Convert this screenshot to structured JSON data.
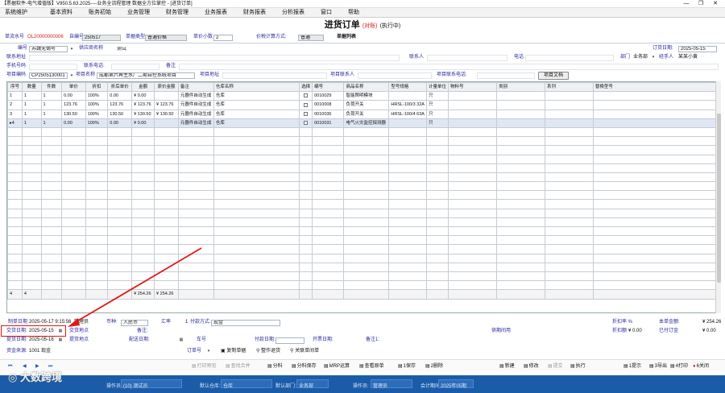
{
  "window": {
    "title": "【票据软件-电气增值版】V950.5.63.2025----业务全流程管理 数据全方位掌控 - [进货订单]",
    "min": "—",
    "max": "❐",
    "close": "✕"
  },
  "menu": [
    "系统维护",
    "基本资料",
    "账务初始",
    "业务管理",
    "财务管理",
    "业务报表",
    "财务报表",
    "分析报表",
    "窗口",
    "帮助"
  ],
  "doc": {
    "title": "进货订单",
    "review": "(对账)",
    "status": "(执行中)"
  },
  "header": {
    "serial_label": "单流水号",
    "serial_value": "OL20000000006",
    "self_no_label": "自编号",
    "self_no_value": "250517",
    "doc_type_label": "单据类型",
    "doc_type_value": "普通价格",
    "unit_dec_label": "单价小数",
    "unit_dec_value": "2",
    "calc_label": "价税计算方式:",
    "calc_value": "普通",
    "list_label": "单据列表",
    "code_label": "编号",
    "code_value": "苏魏无锡号",
    "supplier_label": "供应商名称",
    "supplier_value": "测试",
    "order_date_label": "订货日期:",
    "order_date_value": "2025-05-15",
    "contact_addr_label": "联系地址",
    "contact_label": "联系人",
    "phone_label": "电话",
    "dept_label": "部门",
    "dept_value": "业务部",
    "handler_label": "经手人",
    "handler_value": "某某小黄",
    "mobile_label": "手机号码",
    "contact_phone_label": "联系电话:",
    "remark_label": "备注",
    "proj_no_label": "项目编码",
    "proj_no_value": "CP2505130001",
    "proj_name_label": "项目名称",
    "proj_name_value": "成都第六再生水厂二期自控系统项目",
    "proj_addr_label": "项目地址",
    "proj_contact_label": "项目联系人",
    "proj_phone_label": "项目联系电话:",
    "proj_doc_button": "项目文档"
  },
  "grid": {
    "columns": [
      "序号",
      "数量",
      "件数",
      "单价",
      "折扣",
      "折后单价",
      "金额",
      "原价金额",
      "备注",
      "仓库名称",
      "选择",
      "编号",
      "商品名称",
      "型号规格",
      "计量单位",
      "物料号",
      "类别",
      "系列",
      "替换型号"
    ],
    "rows": [
      [
        "1",
        "1",
        "1",
        "0.00",
        "100%",
        "0.00",
        "¥ 0.00",
        "",
        "元器件自动生成",
        "仓库",
        "",
        "0010029",
        "智能照明模块",
        "",
        "只",
        "",
        "",
        "",
        ""
      ],
      [
        "2",
        "1",
        "1",
        "123.76",
        "100%",
        "123.76",
        "¥ 123.76",
        "¥ 123.76",
        "元器件自动生成",
        "仓库",
        "",
        "0010008",
        "负荷开关",
        "HRSL-100/3 32A",
        "只",
        "",
        "",
        "",
        ""
      ],
      [
        "3",
        "1",
        "1",
        "130.50",
        "100%",
        "130.50",
        "¥ 130.50",
        "¥ 130.50",
        "元器件自动生成",
        "仓库",
        "",
        "0010036",
        "负荷开关",
        "HRSL-100/4 63A",
        "只",
        "",
        "",
        "",
        ""
      ],
      [
        "4",
        "1",
        "1",
        "0.00",
        "100%",
        "0.00",
        "¥ 0.00",
        "",
        "元器件自动生成",
        "仓库",
        "",
        "0010031",
        "电气火灾监控探测器",
        "",
        "只",
        "",
        "",
        "",
        ""
      ]
    ],
    "current_marker": "▸",
    "totals": {
      "seq": "4",
      "qty": "4",
      "amount": "¥ 254.26",
      "orig_amount": "¥ 254.26"
    }
  },
  "footer": {
    "create_label": "制单日期",
    "create_value": "2025-05-17 9:15:56",
    "creator_value": "管理员",
    "currency_label": "币种:",
    "currency_value": "人民币",
    "rate_label": "汇率",
    "rate_value": "1",
    "pay_label": "付款方式:",
    "pay_value": "现金",
    "discount_label": "折扣率 %",
    "discount_value": "",
    "total_label": "本单金额:",
    "total_value": "¥ 254.26",
    "delivery_label": "交货日期:",
    "delivery_value": "2025-05-15",
    "delivery_place_label": "交货地点",
    "remark_label": "备注:",
    "invoice_label": "供期间用",
    "disc_amount_label": "折扣额",
    "disc_amount_value": "¥ 0.00",
    "paid_label": "已付订金",
    "paid_value": "¥ 0.00",
    "pickup_date_label": "提货日期:",
    "pickup_date_value": "2025-05-16",
    "pickup_place_label": "提货地点",
    "ship_date_label": "配送日期:",
    "car_label": "车号",
    "pay_date_label": "付款日期:",
    "invoice_no_label": "开票日期:",
    "remark2_label": "备注1:",
    "fund_label": "资金来源:",
    "fund_value": "1001 现金",
    "order_label": "订单号"
  },
  "actions": {
    "copy": "复制单据",
    "resubmit": "整作退货",
    "related": "关联单间单",
    "print_prev": "打印预览",
    "find": "查找合并",
    "split": "分料",
    "split_save": "分料保存",
    "mrp": "MRP运算",
    "view_src": "查看原单",
    "save": "1保存",
    "delete": "2删除",
    "new": "新建",
    "modify": "修改",
    "submit": "提交",
    "exec": "执行",
    "hint": "1提示",
    "export": "3导出",
    "print": "4打印",
    "close": "6关闭"
  },
  "status": {
    "user_label": "操作员:",
    "user_value": "(10) 测试员",
    "wh_label": "默认仓库:",
    "wh_value": "仓库",
    "dept_label": "默认部门:",
    "dept_value": "业务部",
    "oper_label": "操作员:",
    "oper_value": "管理员",
    "period_label": "会计期间:",
    "period_value": "2025年05期"
  },
  "watermark": "大数跨境",
  "colors": {
    "accent": "#1b5ca8",
    "highlight": "#e01818",
    "label": "#2a2aa0"
  }
}
